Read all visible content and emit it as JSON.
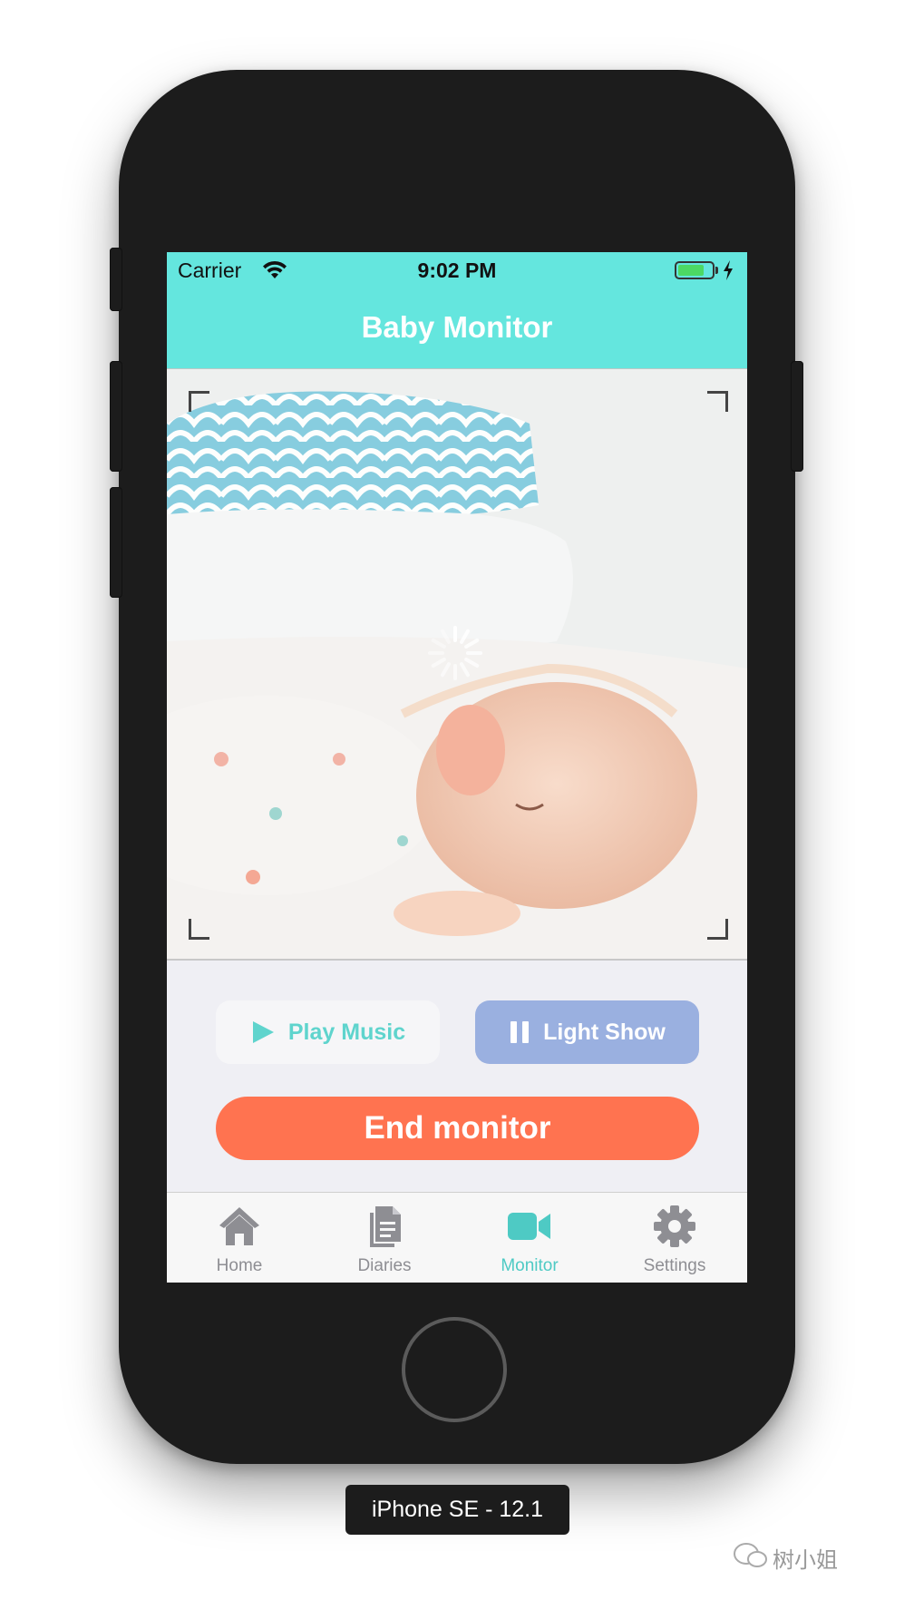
{
  "status": {
    "carrier": "Carrier",
    "time": "9:02 PM"
  },
  "nav": {
    "title": "Baby Monitor"
  },
  "controls": {
    "play_music": "Play Music",
    "light_show": "Light Show",
    "end_monitor": "End monitor"
  },
  "tabs": [
    {
      "label": "Home",
      "icon": "house-icon",
      "active": false
    },
    {
      "label": "Diaries",
      "icon": "document-icon",
      "active": false
    },
    {
      "label": "Monitor",
      "icon": "video-camera-icon",
      "active": true
    },
    {
      "label": "Settings",
      "icon": "gear-icon",
      "active": false
    }
  ],
  "device": {
    "label": "iPhone SE - 12.1"
  },
  "watermark": {
    "text": "树小姐"
  },
  "colors": {
    "accent": "#64e6de",
    "active_tab": "#4ecac4",
    "end_button": "#ff7350",
    "light_show_button": "#9ab0e0",
    "battery": "#4cd964"
  }
}
